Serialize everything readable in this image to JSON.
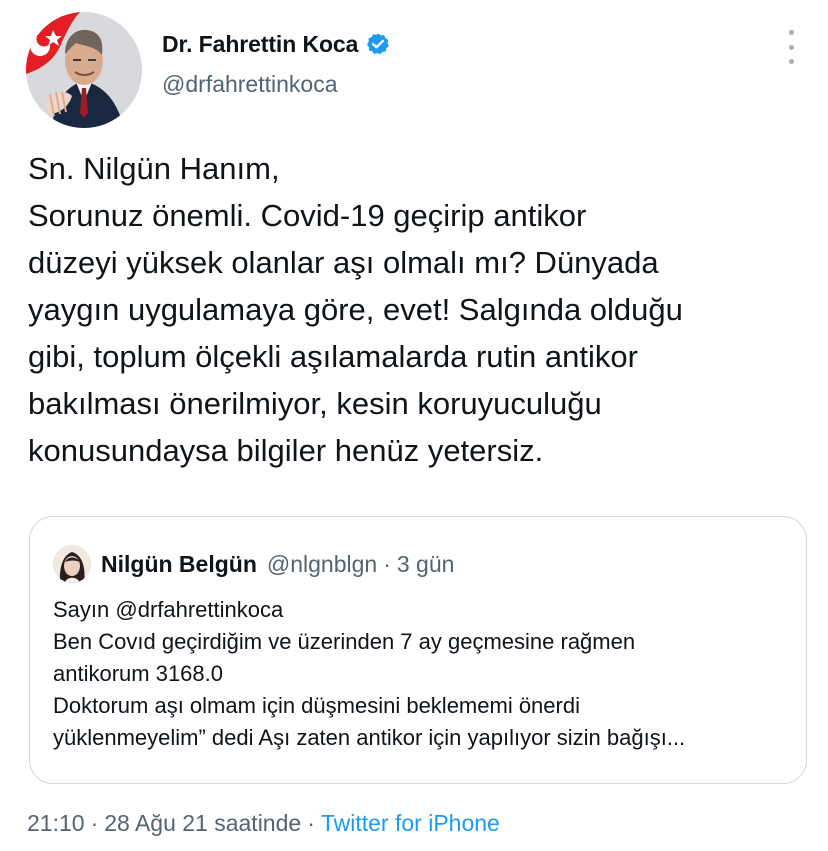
{
  "author": {
    "display_name": "Dr. Fahrettin Koca",
    "handle": "@drfahrettinkoca",
    "avatar_icon": "profile-photo",
    "verified_icon": "verified-badge-icon"
  },
  "menu": {
    "icon": "more-vertical-icon"
  },
  "tweet": {
    "lines": [
      "Sn. Nilgün Hanım,",
      "Sorunuz önemli. Covid-19 geçirip antikor",
      "düzeyi yüksek olanlar aşı olmalı mı? Dünyada",
      "yaygın uygulamaya göre, evet! Salgında olduğu",
      "gibi, toplum ölçekli aşılamalarda rutin antikor",
      "bakılması önerilmiyor, kesin koruyuculuğu",
      "konusundaysa bilgiler henüz yetersiz."
    ]
  },
  "quoted_tweet": {
    "display_name": "Nilgün Belgün",
    "handle": "@nlgnblgn",
    "separator": "·",
    "age": "3 gün",
    "avatar_icon": "profile-photo",
    "lines": [
      "Sayın @drfahrettinkoca",
      "Ben Covıd geçirdiğim ve üzerinden 7 ay geçmesine rağmen",
      "antikorum 3168.0",
      "Doktorum aşı olmam için düşmesini beklememi önerdi",
      "yüklenmeyelim” dedi Aşı zaten antikor için yapılıyor sizin bağışı..."
    ]
  },
  "footer": {
    "time": "21:10",
    "separator": "·",
    "date_text": "28 Ağu 21 saatinde",
    "source": "Twitter for iPhone"
  },
  "colors": {
    "text": "#0f1419",
    "secondary": "#536471",
    "accent": "#1d9bf0",
    "border": "#cfd9de"
  }
}
